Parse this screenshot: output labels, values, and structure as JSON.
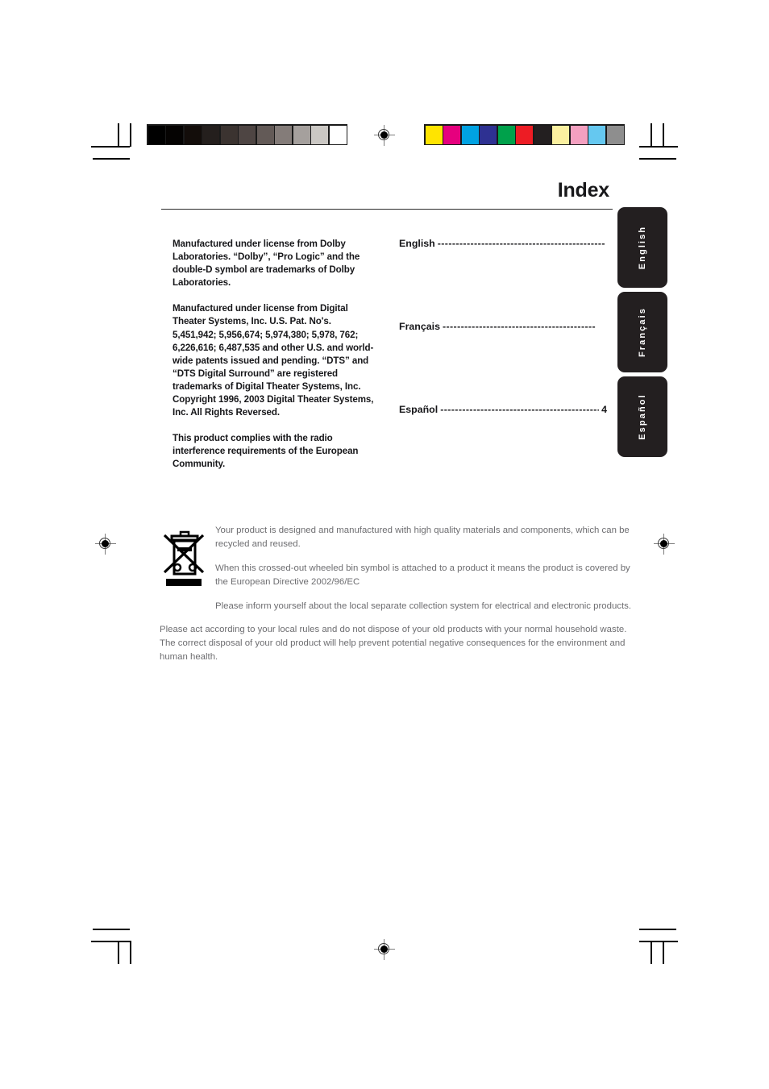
{
  "page": {
    "title": "Index"
  },
  "calibration": {
    "grayscale_label": "grayscale-calibration-bar",
    "grayscale_swatches": [
      "#000000",
      "#050302",
      "#130d0a",
      "#241f1d",
      "#3b3330",
      "#4e4543",
      "#635a57",
      "#847c79",
      "#a5a09d",
      "#cbc8c4",
      "#ffffff"
    ],
    "color_label": "color-calibration-bar",
    "color_swatches": [
      "#ffe400",
      "#e6007e",
      "#00a2e2",
      "#2e3192",
      "#00a14b",
      "#ed1c24",
      "#231f20",
      "#fbf0a0",
      "#f4a0c0",
      "#65c8f0",
      "#8e8e8e"
    ]
  },
  "legal": {
    "paragraphs": [
      "Manufactured under license from Dolby Laboratories. “Dolby”, “Pro Logic” and the double-D symbol are trademarks of Dolby Laboratories.",
      "Manufactured under license from Digital Theater Systems, Inc. U.S. Pat. No's. 5,451,942; 5,956,674; 5,974,380; 5,978, 762; 6,226,616; 6,487,535 and other U.S. and world-wide patents issued and pending. “DTS” and “DTS Digital Surround” are registered trademarks of Digital Theater Systems, Inc. Copyright 1996, 2003 Digital Theater Systems, Inc. All Rights Reversed.",
      "This product complies with the radio interference requirements of the European Community."
    ]
  },
  "toc": {
    "entries": [
      {
        "label": "English",
        "dashes": "------------------------------------------------",
        "page": ""
      },
      {
        "label": "Français",
        "dashes": "------------------------------------------",
        "page": ""
      },
      {
        "label": "Español",
        "dashes": "---------------------------------------------",
        "page": "4"
      }
    ]
  },
  "language_tabs": {
    "items": [
      {
        "label": "English"
      },
      {
        "label": "Français"
      },
      {
        "label": "Español"
      }
    ],
    "background_color": "#231f20",
    "text_color": "#ffffff"
  },
  "weee": {
    "icon_name": "crossed-out-wheeled-bin-icon",
    "paragraphs": [
      "Your product is designed and manufactured with high quality materials and components, which can be recycled and reused.",
      "When this crossed-out wheeled bin symbol is attached to a product it means the product is covered by the European Directive 2002/96/EC",
      "Please inform yourself about the local separate collection system for electrical and electronic products."
    ],
    "footer": "Please act according to your local rules and do not dispose of your old products with your normal household waste. The correct disposal of your old product will help prevent potential negative consequences for the environment and human health."
  },
  "print_marks": {
    "registration_target_name": "registration-target-mark",
    "crop_mark_name": "crop-mark"
  }
}
